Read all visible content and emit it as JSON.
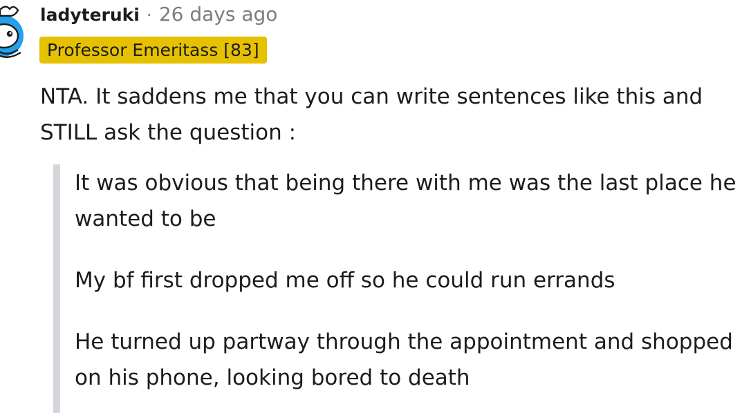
{
  "comment": {
    "username": "ladyteruki",
    "separator": "·",
    "timestamp": "26 days ago",
    "flair": "Professor Emeritass [83]",
    "body": "NTA. It saddens me that you can write sentences like this and STILL ask the question :",
    "quotes": [
      "It was obvious that being there with me was the last place he wanted to be",
      "My bf first dropped me off so he could run errands",
      "He turned up partway through the appointment and shopped on his phone, looking bored to death"
    ]
  },
  "colors": {
    "flair_background": "#e5c100",
    "quote_border": "#d3d6da",
    "avatar_blue": "#24a0ed",
    "meta_text": "#7c7c7c"
  },
  "icons": {
    "avatar": "snoo-avatar-icon"
  }
}
